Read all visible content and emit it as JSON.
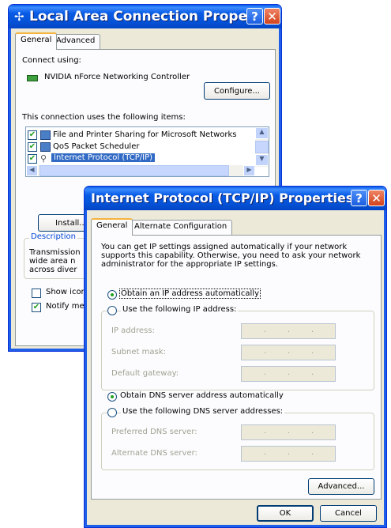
{
  "back_window": {
    "title": "Local Area Connection Prope...",
    "help_button": "?",
    "close_button": "✕",
    "tabs": [
      {
        "label": "General",
        "active": true
      },
      {
        "label": "Advanced",
        "active": false
      }
    ],
    "connect_using_label": "Connect using:",
    "adapter_name": "NVIDIA nForce Networking Controller",
    "configure_button": "Configure...",
    "items_label": "This connection uses the following items:",
    "items": [
      {
        "label": "File and Printer Sharing for Microsoft Networks",
        "checked": true,
        "selected": false
      },
      {
        "label": "QoS Packet Scheduler",
        "checked": true,
        "selected": false
      },
      {
        "label": "Internet Protocol (TCP/IP)",
        "checked": true,
        "selected": true
      }
    ],
    "install_button": "Install...",
    "description_label": "Description",
    "description_lines": [
      "Transmission",
      "wide area n",
      "across diver"
    ],
    "show_icon_label": "Show icon",
    "show_icon_checked": false,
    "notify_label": "Notify me w",
    "notify_checked": true
  },
  "front_window": {
    "title": "Internet Protocol (TCP/IP) Properties",
    "help_button": "?",
    "close_button": "✕",
    "tabs": [
      {
        "label": "General",
        "active": true
      },
      {
        "label": "Alternate Configuration",
        "active": false
      }
    ],
    "intro_text": "You can get IP settings assigned automatically if your network supports this capability. Otherwise, you need to ask your network administrator for the appropriate IP settings.",
    "obtain_ip_auto": "Obtain an IP address automatically",
    "use_following_ip": "Use the following IP address:",
    "ip_address_label": "IP address:",
    "subnet_mask_label": "Subnet mask:",
    "default_gateway_label": "Default gateway:",
    "obtain_dns_auto": "Obtain DNS server address automatically",
    "use_following_dns": "Use the following DNS server addresses:",
    "preferred_dns_label": "Preferred DNS server:",
    "alternate_dns_label": "Alternate DNS server:",
    "ip_dot": ".",
    "advanced_button": "Advanced...",
    "ok_button": "OK",
    "cancel_button": "Cancel",
    "ip_mode": "automatic",
    "dns_mode": "automatic"
  },
  "colors": {
    "titlebar_blue": "#0a5ce6",
    "dialog_face": "#ece9d8",
    "selection_blue": "#316ac5",
    "radio_green": "#21a121"
  }
}
